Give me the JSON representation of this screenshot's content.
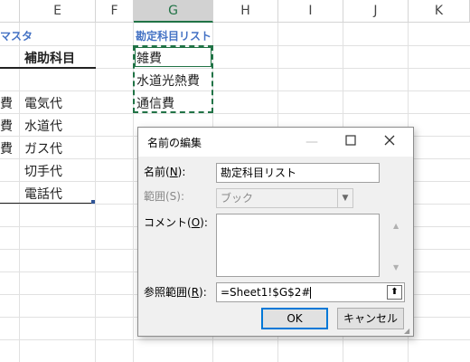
{
  "columns": {
    "e": "E",
    "f": "F",
    "g": "G",
    "h": "H",
    "i": "I",
    "j": "J",
    "k": "K"
  },
  "cells": {
    "d1": "マスタ",
    "e2": "補助科目",
    "d4": "費",
    "e4": "電気代",
    "d5": "費",
    "e5": "水道代",
    "d6": "費",
    "e6": "ガス代",
    "e7": "切手代",
    "e8": "電話代",
    "g1": "勘定科目リスト",
    "g2": "雑費",
    "g3": "水道光熱費",
    "g4": "通信費"
  },
  "dialog": {
    "title": "名前の編集",
    "minimize_icon": "minimize-icon",
    "maximize_icon": "maximize-icon",
    "close_icon": "close-icon",
    "name_label_pre": "名前(",
    "name_label_key": "N",
    "name_label_post": "):",
    "name_value": "勘定科目リスト",
    "scope_label": "範囲(S):",
    "scope_value": "ブック",
    "comment_label_pre": "コメント(",
    "comment_label_key": "O",
    "comment_label_post": "):",
    "comment_value": "",
    "refers_label_pre": "参照範囲(",
    "refers_label_key": "R",
    "refers_label_post": "):",
    "refers_value": "=Sheet1!$G$2#",
    "ok_label": "OK",
    "cancel_label": "キャンセル"
  },
  "colors": {
    "accent": "#217346",
    "header_blue": "#4472c4",
    "ok_border": "#0078d7"
  }
}
